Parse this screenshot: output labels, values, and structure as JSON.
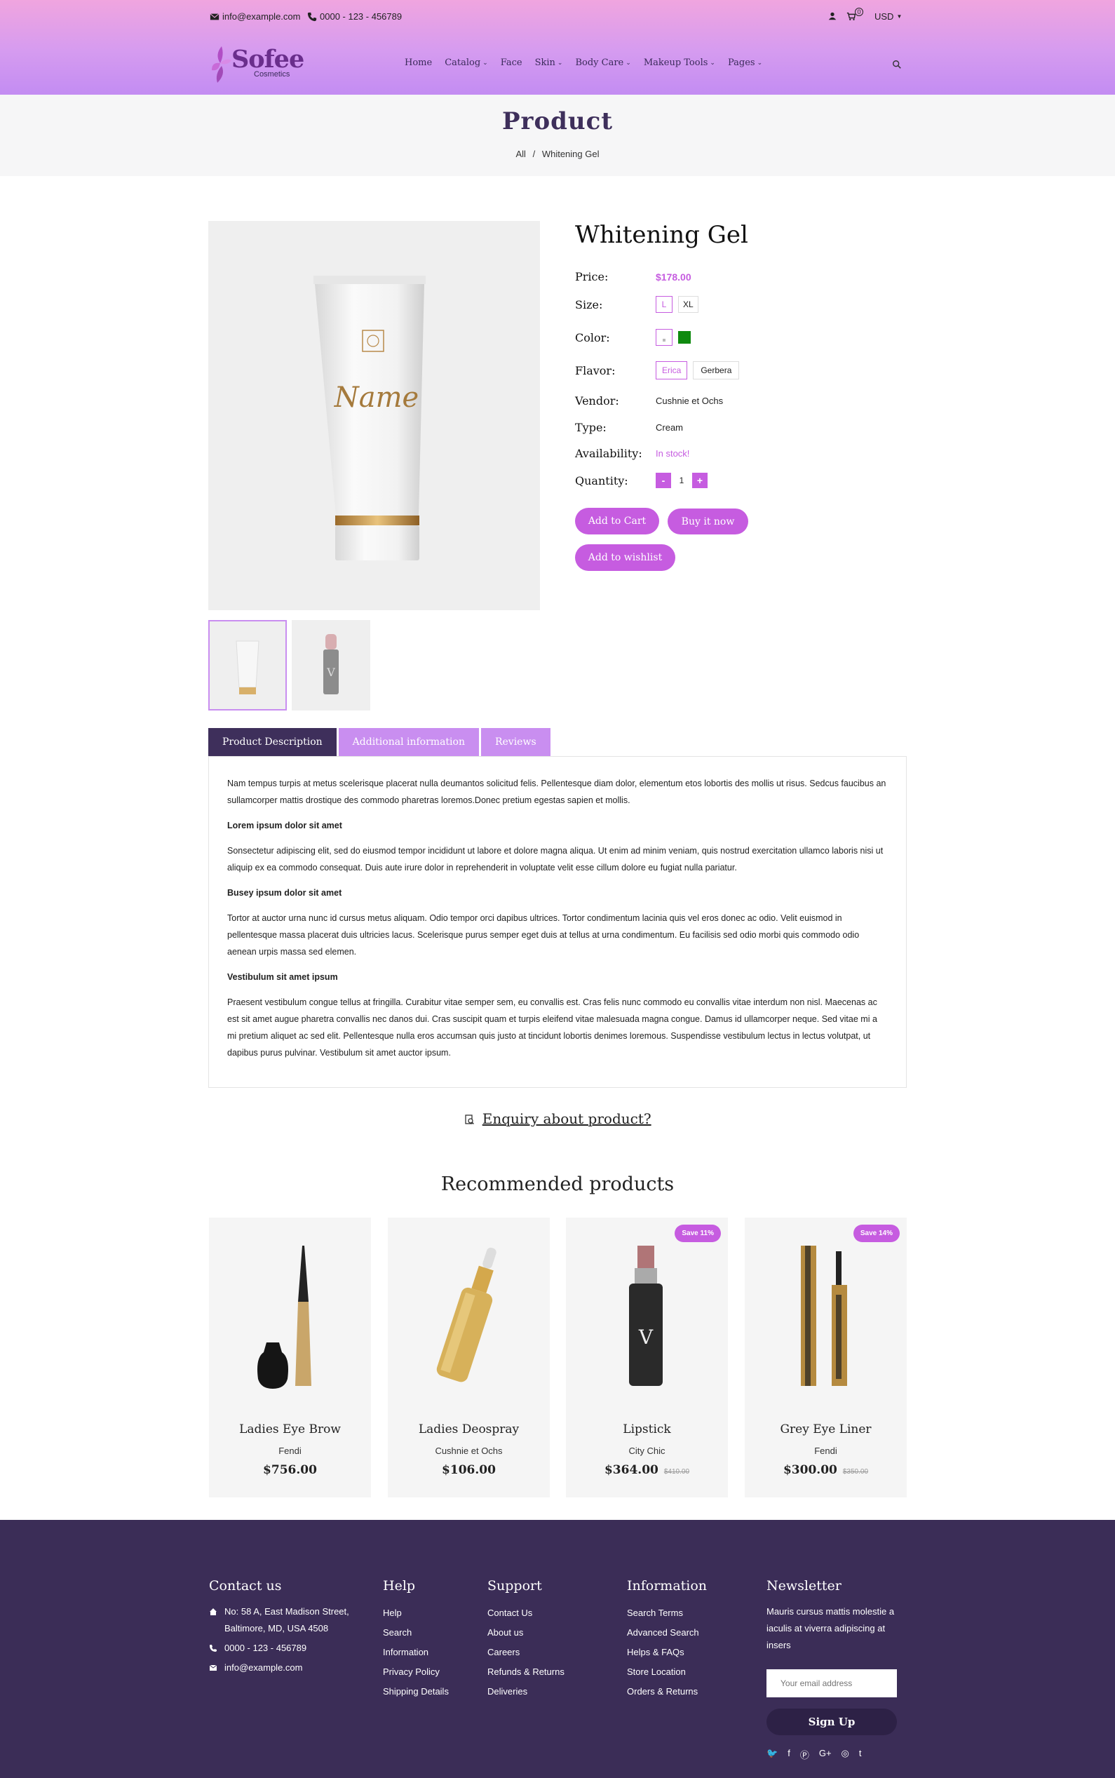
{
  "topbar": {
    "email": "info@example.com",
    "phone": "0000 - 123 - 456789",
    "cart_count": "0",
    "currency": "USD"
  },
  "logo": {
    "name": "Sofee",
    "sub": "Cosmetics"
  },
  "nav": [
    {
      "label": "Home",
      "dd": false
    },
    {
      "label": "Catalog",
      "dd": true
    },
    {
      "label": "Face",
      "dd": false
    },
    {
      "label": "Skin",
      "dd": true
    },
    {
      "label": "Body Care",
      "dd": true
    },
    {
      "label": "Makeup Tools",
      "dd": true
    },
    {
      "label": "Pages",
      "dd": true
    }
  ],
  "banner": {
    "title": "Product",
    "crumb_all": "All",
    "crumb_sep": "/",
    "crumb_current": "Whitening Gel"
  },
  "product": {
    "title": "Whitening Gel",
    "price_label": "Price:",
    "price": "$178.00",
    "size_label": "Size:",
    "sizes": [
      "L",
      "XL"
    ],
    "color_label": "Color:",
    "color_swatches": [
      "#ffffff",
      "#0f8a0f"
    ],
    "flavor_label": "Flavor:",
    "flavors": [
      "Erica",
      "Gerbera"
    ],
    "vendor_label": "Vendor:",
    "vendor": "Cushnie et Ochs",
    "type_label": "Type:",
    "type": "Cream",
    "avail_label": "Availability:",
    "avail": "In stock!",
    "qty_label": "Quantity:",
    "qty": "1",
    "minus": "-",
    "plus": "+",
    "add_to_cart": "Add to Cart",
    "buy_now": "Buy it now",
    "wishlist": "Add to wishlist",
    "tube_text": "Name"
  },
  "tabs": [
    "Product Description",
    "Additional information",
    "Reviews"
  ],
  "description": {
    "p1": "Nam tempus turpis at metus scelerisque placerat nulla deumantos solicitud felis. Pellentesque diam dolor, elementum etos lobortis des mollis ut risus. Sedcus faucibus an sullamcorper mattis drostique des commodo pharetras loremos.Donec pretium egestas sapien et mollis.",
    "h1": "Lorem ipsum dolor sit amet",
    "p2": "Sonsectetur adipiscing elit, sed do eiusmod tempor incididunt ut labore et dolore magna aliqua. Ut enim ad minim veniam, quis nostrud exercitation ullamco laboris nisi ut aliquip ex ea commodo consequat. Duis aute irure dolor in reprehenderit in voluptate velit esse cillum dolore eu fugiat nulla pariatur.",
    "h2": "Busey ipsum dolor sit amet",
    "p3": "Tortor at auctor urna nunc id cursus metus aliquam. Odio tempor orci dapibus ultrices. Tortor condimentum lacinia quis vel eros donec ac odio. Velit euismod in pellentesque massa placerat duis ultricies lacus. Scelerisque purus semper eget duis at tellus at urna condimentum. Eu facilisis sed odio morbi quis commodo odio aenean urpis massa sed elemen.",
    "h3": "Vestibulum sit amet ipsum",
    "p4": "Praesent vestibulum congue tellus at fringilla. Curabitur vitae semper sem, eu convallis est. Cras felis nunc commodo eu convallis vitae interdum non nisl. Maecenas ac est sit amet augue pharetra convallis nec danos dui. Cras suscipit quam et turpis eleifend vitae malesuada magna congue. Damus id ullamcorper neque. Sed vitae mi a mi pretium aliquet ac sed elit. Pellentesque nulla eros accumsan quis justo at tincidunt lobortis denimes loremous. Suspendisse vestibulum lectus in lectus volutpat, ut dapibus purus pulvinar. Vestibulum sit amet auctor ipsum."
  },
  "enquiry": "Enquiry about product?",
  "recommended": {
    "title": "Recommended products",
    "items": [
      {
        "name": "Ladies Eye Brow",
        "vendor": "Fendi",
        "price": "$756.00",
        "old": "",
        "badge": ""
      },
      {
        "name": "Ladies Deospray",
        "vendor": "Cushnie et Ochs",
        "price": "$106.00",
        "old": "",
        "badge": ""
      },
      {
        "name": "Lipstick",
        "vendor": "City Chic",
        "price": "$364.00",
        "old": "$410.00",
        "badge": "Save 11%"
      },
      {
        "name": "Grey Eye Liner",
        "vendor": "Fendi",
        "price": "$300.00",
        "old": "$350.00",
        "badge": "Save 14%"
      }
    ]
  },
  "footer": {
    "contact": {
      "title": "Contact us",
      "address": "No: 58 A, East Madison Street, Baltimore, MD, USA 4508",
      "phone": "0000 - 123 - 456789",
      "email": "info@example.com"
    },
    "help": {
      "title": "Help",
      "links": [
        "Help",
        "Search",
        "Information",
        "Privacy Policy",
        "Shipping Details"
      ]
    },
    "support": {
      "title": "Support",
      "links": [
        "Contact Us",
        "About us",
        "Careers",
        "Refunds & Returns",
        "Deliveries"
      ]
    },
    "information": {
      "title": "Information",
      "links": [
        "Search Terms",
        "Advanced Search",
        "Helps & FAQs",
        "Store Location",
        "Orders & Returns"
      ]
    },
    "newsletter": {
      "title": "Newsletter",
      "text": "Mauris cursus mattis molestie a iaculis at viverra adipiscing at insers",
      "placeholder": "Your email address",
      "button": "Sign Up"
    }
  }
}
